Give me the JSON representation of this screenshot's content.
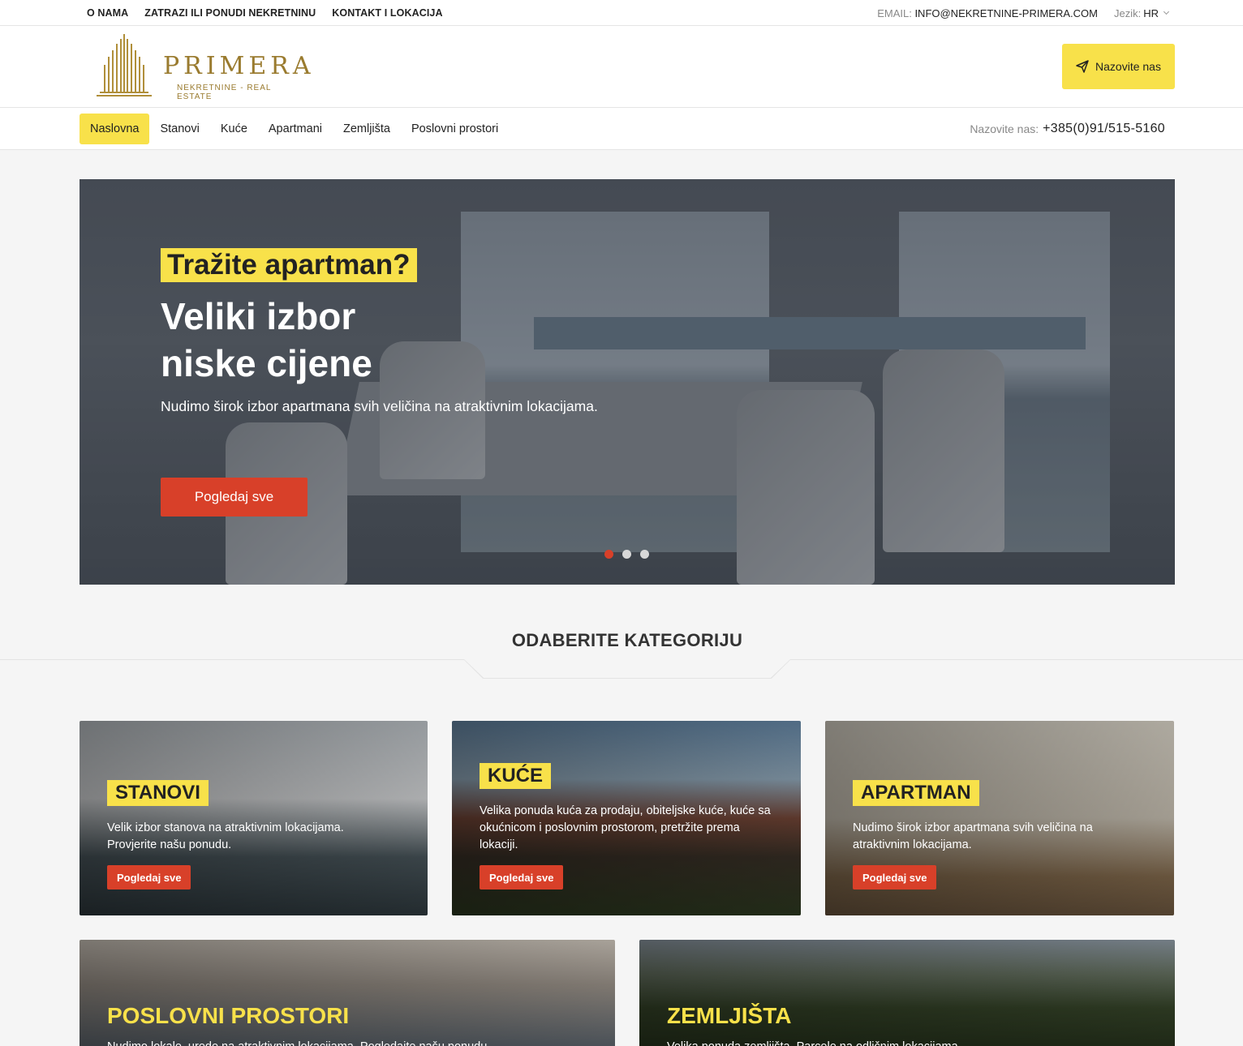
{
  "topbar": {
    "links": [
      "O NAMA",
      "ZATRAZI ILI PONUDI NEKRETNINU",
      "KONTAKT I LOKACIJA"
    ],
    "email_label": "EMAIL:",
    "email": "INFO@NEKRETNINE-PRIMERA.COM",
    "lang_label": "Jezik:",
    "lang_value": "HR"
  },
  "header": {
    "brand": "PRIMERA",
    "tagline": "NEKRETNINE - REAL ESTATE",
    "call_button": "Nazovite nas",
    "call_icon": "paper-plane-icon"
  },
  "nav": {
    "items": [
      "Naslovna",
      "Stanovi",
      "Kuće",
      "Apartmani",
      "Zemljišta",
      "Poslovni prostori"
    ],
    "active": "Naslovna",
    "phone_label": "Nazovite nas:",
    "phone": "+385(0)91/515-5160"
  },
  "hero": {
    "tag": "Tražite apartman?",
    "title_line1": "Veliki izbor",
    "title_line2": "niske cijene",
    "lead": "Nudimo širok izbor apartmana svih veličina na atraktivnim lokacijama.",
    "cta": "Pogledaj sve",
    "slides": 3,
    "active_slide": 1
  },
  "categories_title": "ODABERITE KATEGORIJU",
  "categories": [
    {
      "title": "STANOVI",
      "text": "Velik izbor stanova na atraktivnim lokacijama. Provjerite našu ponudu.",
      "button": "Pogledaj sve"
    },
    {
      "title": "KUĆE",
      "text": "Velika ponuda kuća za prodaju, obiteljske kuće, kuće sa okućnicom i poslovnim prostorom, pretržite prema lokaciji.",
      "button": "Pogledaj sve"
    },
    {
      "title": "APARTMAN",
      "text": "Nudimo širok izbor apartmana svih veličina na atraktivnim lokacijama.",
      "button": "Pogledaj sve"
    },
    {
      "title": "POSLOVNI PROSTORI",
      "text": "Nudimo lokale, urede na atraktivnim lokacijama. Pogledajte našu ponudu..."
    },
    {
      "title": "ZEMLJIŠTA",
      "text": "Velika ponuda zemljišta. Parcele na odličnim lokacijama..."
    }
  ],
  "colors": {
    "accent_yellow": "#f8e14a",
    "cta_red": "#d84029",
    "brand_gold": "#9a7b2f"
  }
}
